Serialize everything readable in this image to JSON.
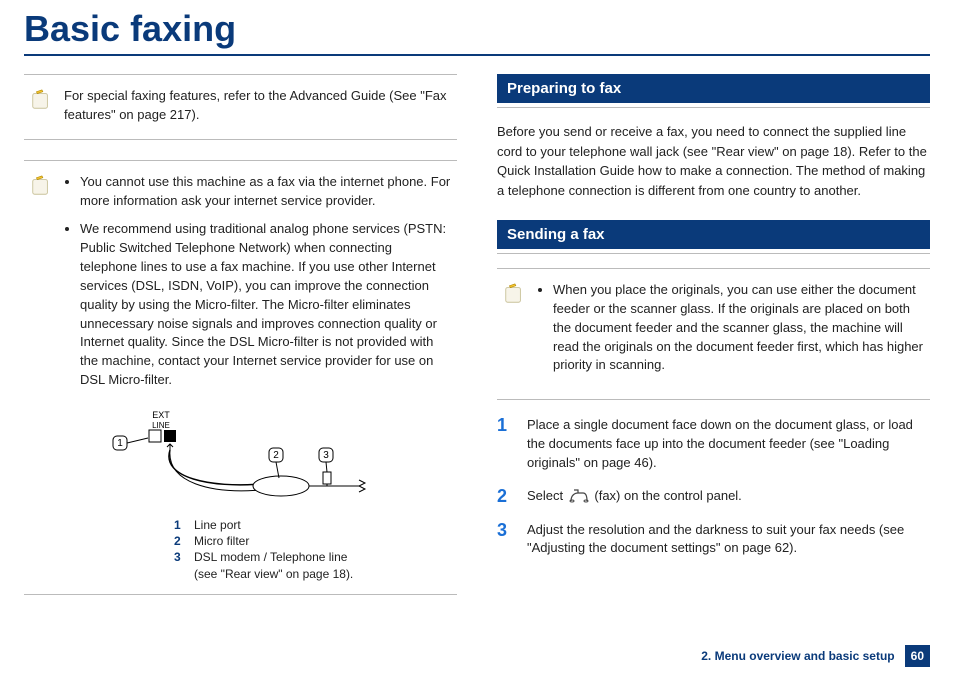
{
  "title": "Basic faxing",
  "left": {
    "note1": "For special faxing features, refer to the Advanced Guide (See \"Fax features\" on page 217).",
    "note2": {
      "b1": "You cannot use this machine as a fax via the internet phone. For more information ask your internet service provider.",
      "b2": "We recommend using traditional analog phone services (PSTN: Public Switched Telephone Network) when connecting telephone lines to use a fax machine. If you use other Internet services (DSL, ISDN, VoIP), you can improve the connection quality by using the Micro-filter. The Micro-filter eliminates unnecessary noise signals and improves connection quality or Internet quality. Since the DSL Micro-filter is not provided with the machine, contact your Internet service provider for use on DSL Micro-filter."
    },
    "diagram": {
      "ext": "EXT",
      "line": "LINE",
      "c1": "1",
      "c2": "2",
      "c3": "3"
    },
    "legend": {
      "l1n": "1",
      "l1t": "Line port",
      "l2n": "2",
      "l2t": "Micro filter",
      "l3n": "3",
      "l3t": "DSL modem / Telephone line",
      "l3s": "(see \"Rear view\" on page 18)."
    }
  },
  "right": {
    "sec1_title": "Preparing to fax",
    "sec1_text": "Before you send or receive a fax, you need to connect the supplied line cord to your telephone wall jack (see \"Rear view\" on page 18). Refer to the Quick Installation Guide how to make a connection. The method of making a telephone connection is different from one country to another.",
    "sec2_title": "Sending a fax",
    "note3": "When you place the originals, you can use either the document feeder or the scanner glass. If the originals are placed on both the document feeder and the scanner glass, the machine will read the originals on the document feeder first, which has higher priority in scanning.",
    "steps": {
      "s1n": "1",
      "s1": "Place a single document face down on the document glass, or load the documents face up into the document feeder (see \"Loading originals\" on page 46).",
      "s2n": "2",
      "s2a": "Select ",
      "s2b": "(fax) on the control panel.",
      "s3n": "3",
      "s3": "Adjust the resolution and the darkness to suit your fax needs (see \"Adjusting the document settings\" on page 62)."
    }
  },
  "footer": {
    "chapter": "2. Menu overview and basic setup",
    "page": "60"
  }
}
